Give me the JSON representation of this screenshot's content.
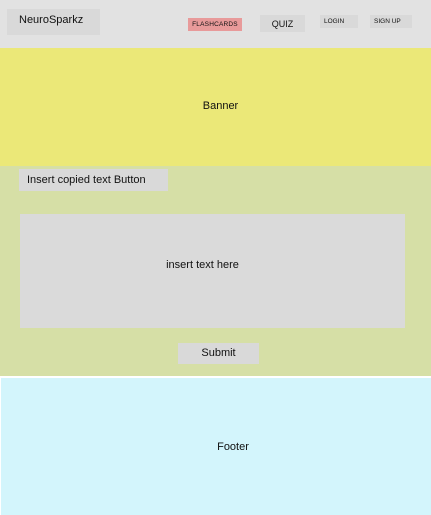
{
  "header": {
    "brand": "NeuroSparkz",
    "nav": {
      "flashcards": "FLASHCARDS",
      "quiz": "QUIZ",
      "login": "LOGIN",
      "signup": "SIGN UP"
    }
  },
  "banner": {
    "label": "Banner"
  },
  "main": {
    "insert_button": "Insert copied text Button",
    "text_area_placeholder": "insert text here",
    "submit_button": "Submit"
  },
  "footer": {
    "label": "Footer"
  },
  "colors": {
    "header_bg": "#e2e2e2",
    "banner_bg": "#ebe878",
    "content_bg": "#d6dfa6",
    "footer_bg": "#d3f5fc",
    "active_nav": "#e89a9a",
    "placeholder_box": "#d9d9d9"
  }
}
